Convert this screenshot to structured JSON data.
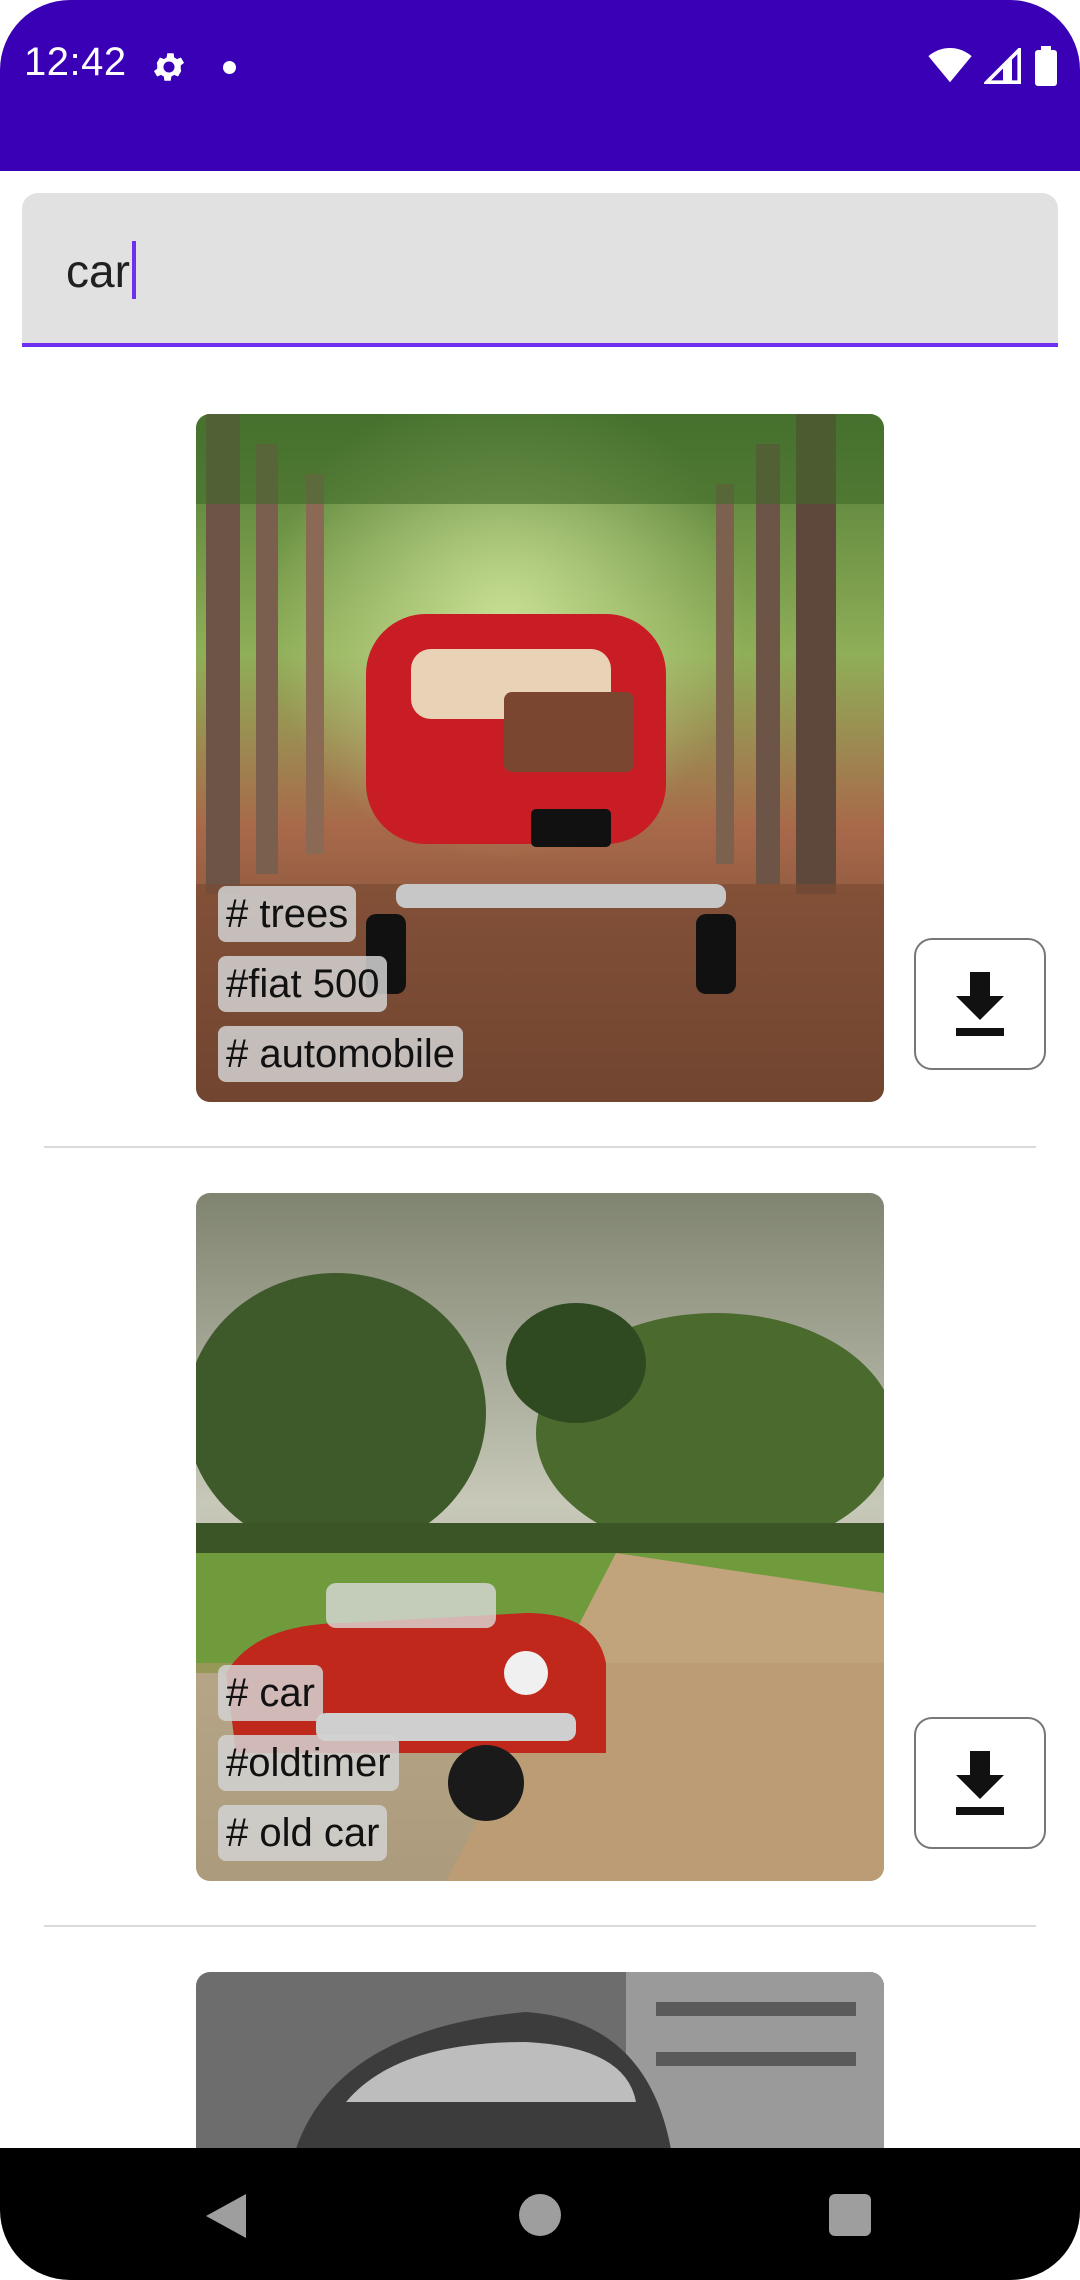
{
  "status_bar": {
    "time": "12:42",
    "icons": [
      "gear-icon",
      "notification-dot-icon",
      "wifi-icon",
      "signal-icon",
      "battery-icon"
    ]
  },
  "search": {
    "value": "car",
    "placeholder": ""
  },
  "results": [
    {
      "tags": [
        "# trees",
        "#fiat 500",
        "# automobile"
      ],
      "download_icon": "download-icon"
    },
    {
      "tags": [
        "# car",
        "#oldtimer",
        "# old car"
      ],
      "download_icon": "download-icon"
    },
    {
      "tags": []
    }
  ],
  "nav_bar": {
    "icons": [
      "back-icon",
      "home-icon",
      "recents-icon"
    ]
  },
  "colors": {
    "app_bar": "#3a00b6",
    "accent": "#6f2ff0",
    "field_bg": "#e1e1e1"
  }
}
